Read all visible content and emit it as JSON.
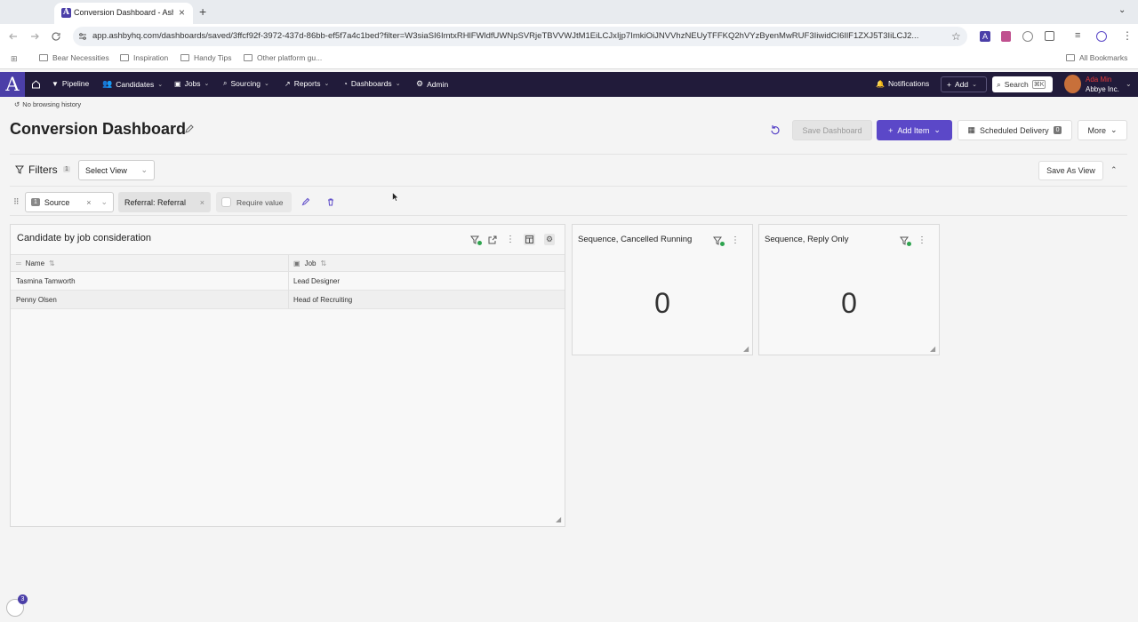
{
  "browser": {
    "tab_title": "Conversion Dashboard - Ashb",
    "tab_favicon": "A",
    "new_tab": "+",
    "url": "app.ashbyhq.com/dashboards/saved/3ffcf92f-3972-437d-86bb-ef5f7a4c1bed?filter=W3siaSI6ImtxRHlFWldfUWNpSVRjeTBVVWJtM1EiLCJxIjp7ImkiOiJNVVhzNEUyTFFKQ2hVYzByenMwRUF3IiwidCI6IlF1ZXJ5T3IiLCJ2...",
    "bookmarks": [
      "Bear Necessities",
      "Inspiration",
      "Handy Tips",
      "Other platform gu..."
    ],
    "all_bookmarks": "All Bookmarks"
  },
  "nav": {
    "logo": "A",
    "items": [
      {
        "label": "Pipeline",
        "icon": "filter-icon",
        "dropdown": false
      },
      {
        "label": "Candidates",
        "icon": "people-icon",
        "dropdown": true
      },
      {
        "label": "Jobs",
        "icon": "briefcase-icon",
        "dropdown": true
      },
      {
        "label": "Sourcing",
        "icon": "search-icon",
        "dropdown": true
      },
      {
        "label": "Reports",
        "icon": "chart-icon",
        "dropdown": true
      },
      {
        "label": "Dashboards",
        "icon": "dashboard-icon",
        "dropdown": true
      },
      {
        "label": "Admin",
        "icon": "gear-icon",
        "dropdown": false
      }
    ],
    "notifications": "Notifications",
    "add": "Add",
    "search": "Search",
    "search_shortcut": "⌘K",
    "user_name": "Ada Min",
    "user_org": "Abbye Inc."
  },
  "page": {
    "history": "No browsing history",
    "title": "Conversion Dashboard",
    "save_dashboard": "Save Dashboard",
    "add_item": "Add Item",
    "scheduled_delivery": "Scheduled Delivery",
    "scheduled_count": "0",
    "more": "More"
  },
  "filters": {
    "label": "Filters",
    "count": "1",
    "select_view": "Select View",
    "save_as_view": "Save As View",
    "source_num": "1",
    "source_label": "Source",
    "value_chip": "Referral: Referral",
    "require_value": "Require value"
  },
  "table_widget": {
    "title": "Candidate by job consideration",
    "columns": [
      "Name",
      "Job"
    ],
    "rows": [
      [
        "Tasmina Tamworth",
        "Lead Designer"
      ],
      [
        "Penny Olsen",
        "Head of Recruiting"
      ]
    ]
  },
  "metrics": [
    {
      "title": "Sequence, Cancelled Running",
      "value": "0"
    },
    {
      "title": "Sequence, Reply Only",
      "value": "0"
    }
  ],
  "help_badge": "3",
  "colors": {
    "brand": "#4b3fa8",
    "nav_bg": "#211b3a",
    "primary_button": "#5b48c8",
    "filter_active_dot": "#2ea44f"
  }
}
